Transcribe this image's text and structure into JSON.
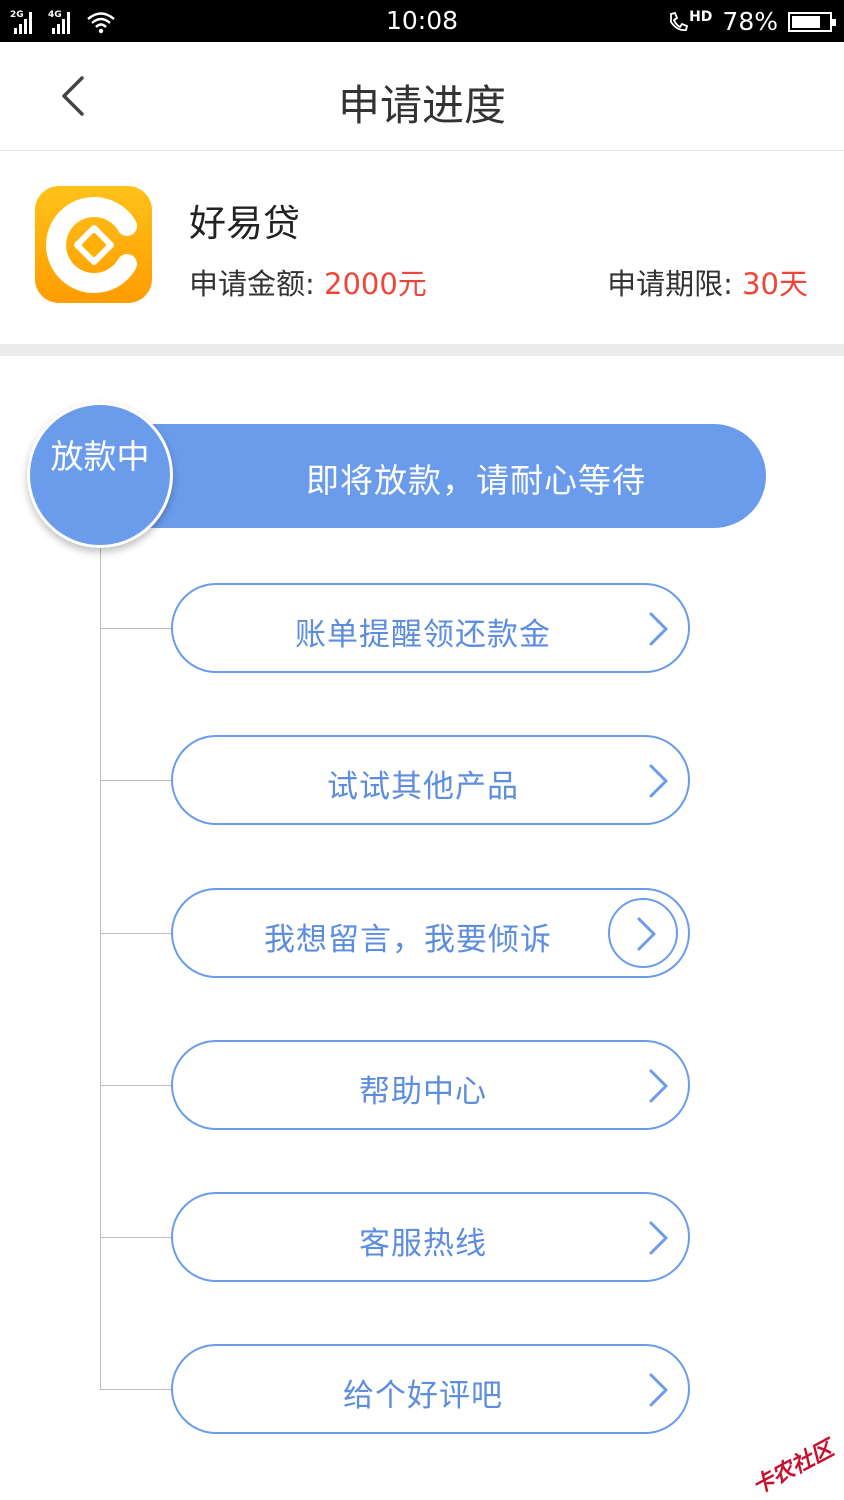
{
  "status_bar": {
    "signal1": "2G",
    "signal2": "4G",
    "time": "10:08",
    "hd": "HD",
    "battery_percent": "78%",
    "battery_level": 0.78
  },
  "header": {
    "title": "申请进度"
  },
  "product": {
    "name": "好易贷",
    "amount_label": "申请金额:",
    "amount_value": "2000元",
    "term_label": "申请期限:",
    "term_value": "30天"
  },
  "progress": {
    "stage": "放款中",
    "message": "即将放款，请耐心等待"
  },
  "actions": [
    {
      "label": "账单提醒领还款金"
    },
    {
      "label": "试试其他产品"
    },
    {
      "label": "我想留言，我要倾诉"
    },
    {
      "label": "帮助中心"
    },
    {
      "label": "客服热线"
    },
    {
      "label": "给个好评吧"
    }
  ],
  "colors": {
    "accent": "#6b9ceb",
    "highlight": "#f0453a",
    "icon_orange": "#ff9c00"
  },
  "watermark": "卡农社区"
}
